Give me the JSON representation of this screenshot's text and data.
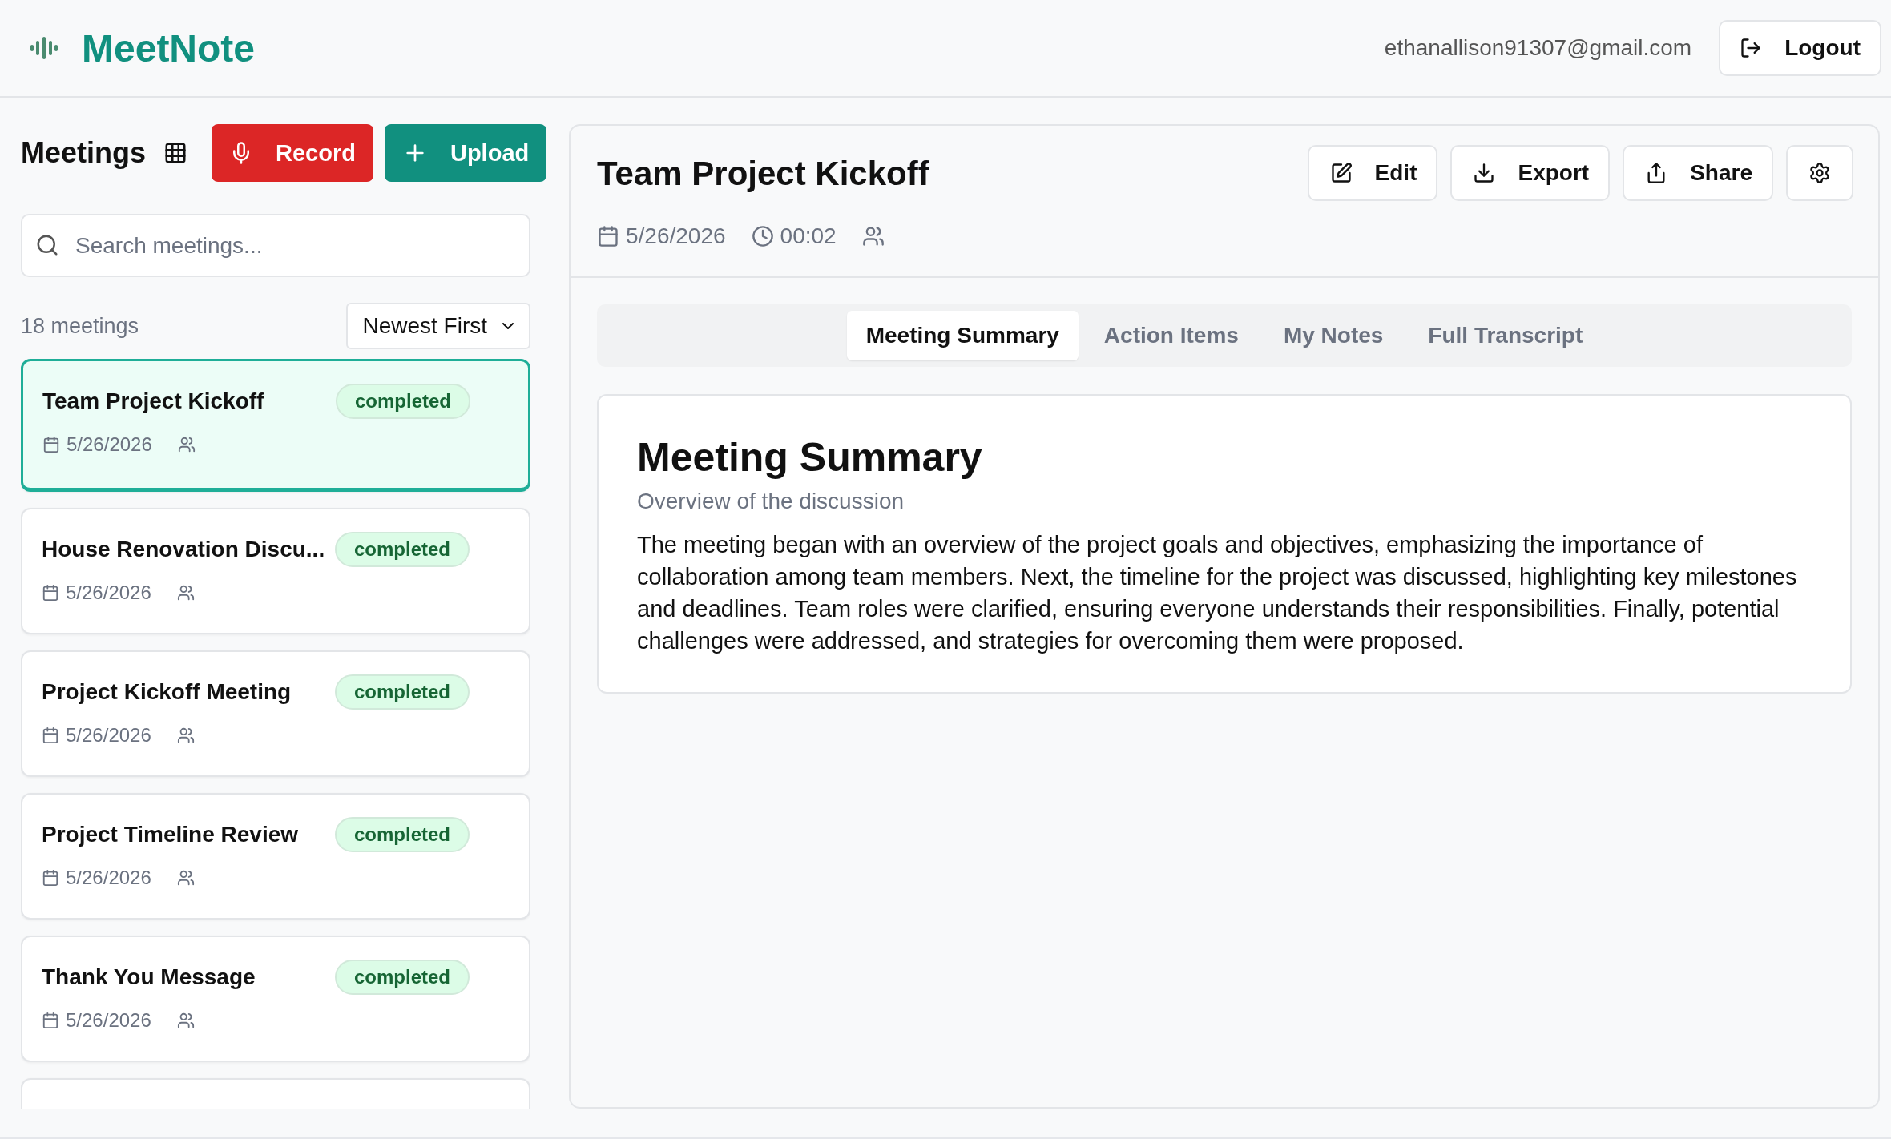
{
  "brand": {
    "name": "MeetNote"
  },
  "user": {
    "email": "ethanallison91307@gmail.com",
    "logout": "Logout"
  },
  "sidebar": {
    "title": "Meetings",
    "record": "Record",
    "upload": "Upload",
    "search": {
      "placeholder": "Search meetings..."
    },
    "count": "18 meetings",
    "sort": "Newest First",
    "meetings": [
      {
        "title": "Team Project Kickoff",
        "status": "completed",
        "date": "5/26/2026",
        "selected": true
      },
      {
        "title": "House Renovation Discu...",
        "status": "completed",
        "date": "5/26/2026",
        "selected": false
      },
      {
        "title": "Project Kickoff Meeting",
        "status": "completed",
        "date": "5/26/2026",
        "selected": false
      },
      {
        "title": "Project Timeline Review",
        "status": "completed",
        "date": "5/26/2026",
        "selected": false
      },
      {
        "title": "Thank You Message",
        "status": "completed",
        "date": "5/26/2026",
        "selected": false
      }
    ]
  },
  "detail": {
    "title": "Team Project Kickoff",
    "date": "5/26/2026",
    "duration": "00:02",
    "actions": [
      {
        "kind": "edit",
        "label": "Edit"
      },
      {
        "kind": "export",
        "label": "Export"
      },
      {
        "kind": "share",
        "label": "Share"
      },
      {
        "kind": "settings"
      }
    ],
    "tabs": [
      {
        "label": "Meeting Summary",
        "selected": true
      },
      {
        "label": "Action Items",
        "selected": false
      },
      {
        "label": "My Notes",
        "selected": false
      },
      {
        "label": "Full Transcript",
        "selected": false
      }
    ],
    "summary": {
      "heading": "Meeting Summary",
      "subtitle": "Overview of the discussion",
      "body": "The meeting began with an overview of the project goals and objectives, emphasizing the importance of collaboration among team members. Next, the timeline for the project was discussed, highlighting key milestones and deadlines. Team roles were clarified, ensuring everyone understands their responsibilities. Finally, potential challenges were addressed, and strategies for overcoming them were proposed."
    }
  }
}
